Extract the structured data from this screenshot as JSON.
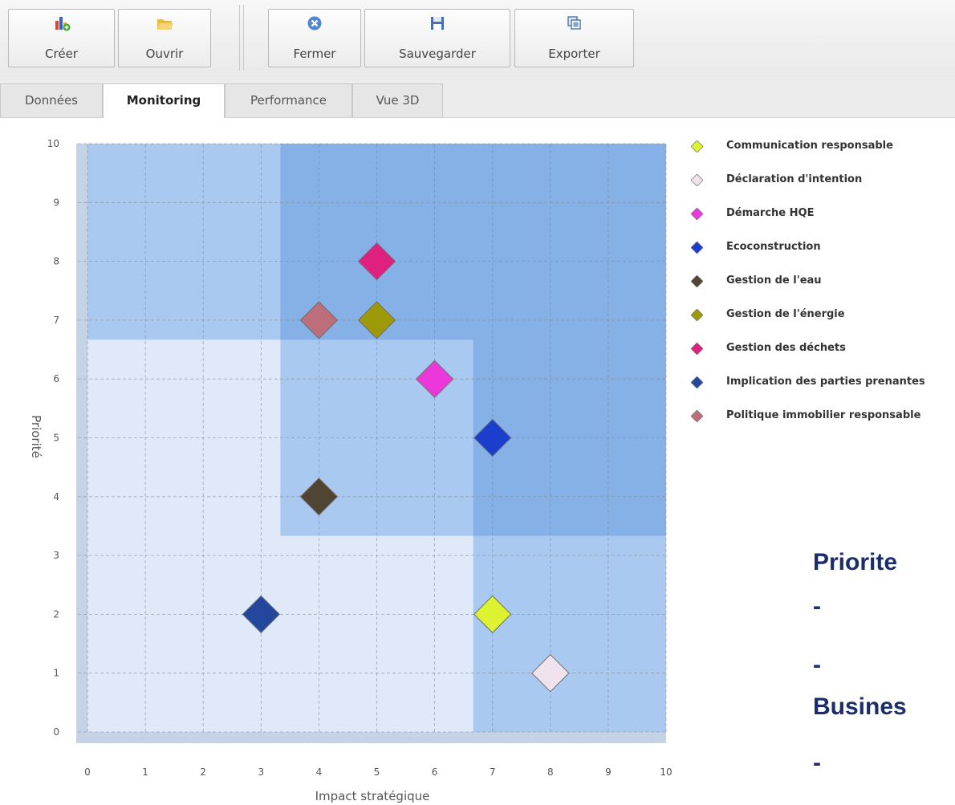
{
  "toolbar": {
    "buttons": [
      {
        "label": "Créer",
        "icon": "create-chart-icon"
      },
      {
        "label": "Ouvrir",
        "icon": "folder-open-icon"
      },
      {
        "label": "Fermer",
        "icon": "close-circle-icon"
      },
      {
        "label": "Sauvegarder",
        "icon": "floppy-disk-icon"
      },
      {
        "label": "Exporter",
        "icon": "export-copy-icon"
      }
    ]
  },
  "tabs": [
    {
      "label": "Données",
      "active": false
    },
    {
      "label": "Monitoring",
      "active": true
    },
    {
      "label": "Performance",
      "active": false
    },
    {
      "label": "Vue 3D",
      "active": false
    }
  ],
  "chart_data": {
    "type": "scatter",
    "xlabel": "Impact stratégique",
    "ylabel": "Priorité",
    "xlim": [
      0,
      10
    ],
    "ylim": [
      0,
      10
    ],
    "xticks": [
      "0",
      "1",
      "2",
      "3",
      "4",
      "5",
      "6",
      "7",
      "8",
      "9",
      "10"
    ],
    "yticks": [
      "0",
      "1",
      "2",
      "3",
      "4",
      "5",
      "6",
      "7",
      "8",
      "9",
      "10"
    ],
    "grid": true,
    "legend_position": "right",
    "marker": "diamond",
    "zone_colors": [
      "#dfe9f8",
      "#a9c9f0",
      "#86b1e6"
    ],
    "series": [
      {
        "name": "Communication responsable",
        "x": 7,
        "y": 2,
        "color": "#ddf230"
      },
      {
        "name": "Déclaration d'intention",
        "x": 8,
        "y": 1,
        "color": "#f1e3ee"
      },
      {
        "name": "Démarche HQE",
        "x": 6,
        "y": 6,
        "color": "#ec38da"
      },
      {
        "name": "Ecoconstruction",
        "x": 7,
        "y": 5,
        "color": "#1b3fcc"
      },
      {
        "name": "Gestion de l'eau",
        "x": 4,
        "y": 4,
        "color": "#4f4532"
      },
      {
        "name": "Gestion de l'énergie",
        "x": 5,
        "y": 7,
        "color": "#9d9908"
      },
      {
        "name": "Gestion des déchets",
        "x": 5,
        "y": 8,
        "color": "#e0207e"
      },
      {
        "name": "Implication des parties prenantes",
        "x": 3,
        "y": 2,
        "color": "#23479c"
      },
      {
        "name": "Politique immobilier responsable",
        "x": 4,
        "y": 7,
        "color": "#bc6f7a"
      }
    ]
  },
  "overlay": {
    "lines": [
      "Priorite",
      "-",
      "-",
      "Busines",
      "-"
    ]
  }
}
